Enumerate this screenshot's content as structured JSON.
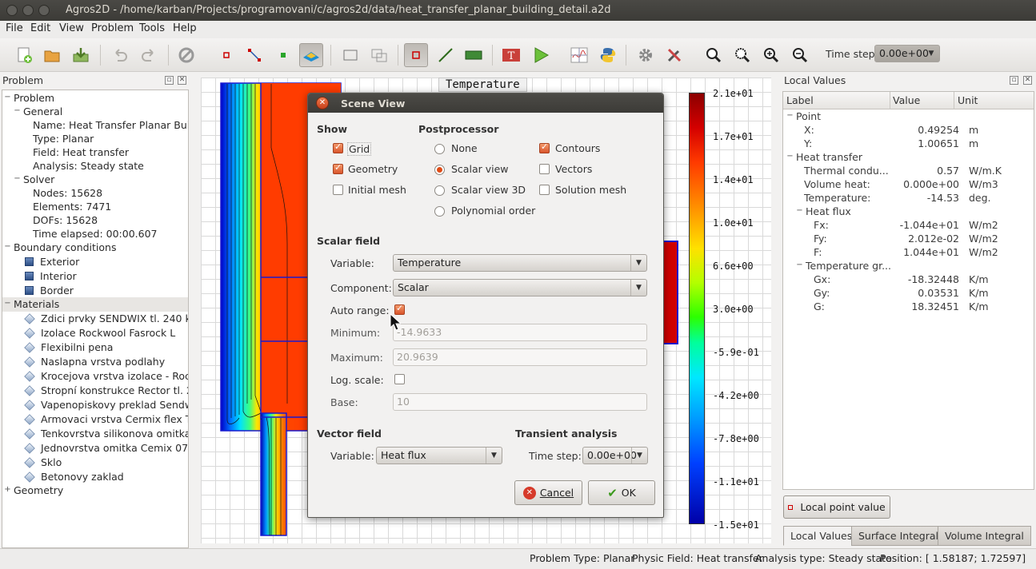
{
  "window": {
    "title": "Agros2D - /home/karban/Projects/programovani/c/agros2d/data/heat_transfer_planar_building_detail.a2d"
  },
  "menu": [
    "File",
    "Edit",
    "View",
    "Problem",
    "Tools",
    "Help"
  ],
  "toolbar": {
    "time_step_label": "Time step:",
    "time_step_value": "0.00e+00"
  },
  "problem_panel": {
    "title": "Problem",
    "tree": {
      "problem": "Problem",
      "general": "General",
      "name": "Name: Heat Transfer Planar Bui...",
      "type": "Type: Planar",
      "field": "Field: Heat transfer",
      "analysis": "Analysis: Steady state",
      "solver": "Solver",
      "nodes": "Nodes: 15628",
      "elements": "Elements: 7471",
      "dofs": "DOFs: 15628",
      "time_elapsed": "Time elapsed: 00:00.607",
      "boundary_conditions": "Boundary conditions",
      "bcs": [
        "Exterior",
        "Interior",
        "Border"
      ],
      "materials_label": "Materials",
      "materials": [
        "Zdici prvky SENDWIX tl. 240 ko...",
        "Izolace Rockwool Fasrock L",
        "Flexibilni pena",
        "Naslapna vrstva podlahy",
        "Krocejova vrstva izolace - Rock...",
        "Stropní konstrukce Rector tl. 2...",
        "Vapenopiskovy preklad Sendw...",
        "Armovaci vrstva Cermix flex T ...",
        "Tenkovrstva silikonova omitka ...",
        "Jednovrstva omitka Cemix 073...",
        "Sklo",
        "Betonovy zaklad"
      ],
      "geometry": "Geometry"
    }
  },
  "scene": {
    "title": "Temperature",
    "colorbar_labels": [
      "2.1e+01",
      "1.7e+01",
      "1.4e+01",
      "1.0e+01",
      "6.6e+00",
      "3.0e+00",
      "-5.9e-01",
      "-4.2e+00",
      "-7.8e+00",
      "-1.1e+01",
      "-1.5e+01"
    ]
  },
  "dialog": {
    "title": "Scene View",
    "show_header": "Show",
    "grid": "Grid",
    "geometry": "Geometry",
    "initial_mesh": "Initial mesh",
    "post_header": "Postprocessor",
    "none": "None",
    "scalar_view": "Scalar view",
    "scalar_view_3d": "Scalar view 3D",
    "polynomial_order": "Polynomial order",
    "contours": "Contours",
    "vectors": "Vectors",
    "solution_mesh": "Solution mesh",
    "scalar_field_header": "Scalar field",
    "variable_label": "Variable:",
    "variable_value": "Temperature",
    "component_label": "Component:",
    "component_value": "Scalar",
    "auto_range_label": "Auto range:",
    "minimum_label": "Minimum:",
    "minimum_value": "-14.9633",
    "maximum_label": "Maximum:",
    "maximum_value": "20.9639",
    "log_scale_label": "Log. scale:",
    "base_label": "Base:",
    "base_value": "10",
    "vector_field_header": "Vector field",
    "vector_variable_label": "Variable:",
    "vector_variable_value": "Heat flux",
    "transient_header": "Transient analysis",
    "time_step_label": "Time step:",
    "time_step_value": "0.00e+00",
    "cancel": "Cancel",
    "ok": "OK"
  },
  "local_values": {
    "title": "Local Values",
    "headers": [
      "Label",
      "Value",
      "Unit"
    ],
    "point": "Point",
    "x": {
      "label": "X:",
      "value": "0.49254",
      "unit": "m"
    },
    "y": {
      "label": "Y:",
      "value": "1.00651",
      "unit": "m"
    },
    "heat_transfer": "Heat transfer",
    "thermal": {
      "label": "Thermal condu...",
      "value": "0.57",
      "unit": "W/m.K"
    },
    "volume_heat": {
      "label": "Volume heat:",
      "value": "0.000e+00",
      "unit": "W/m3"
    },
    "temperature": {
      "label": "Temperature:",
      "value": "-14.53",
      "unit": "deg."
    },
    "heat_flux": "Heat flux",
    "fx": {
      "label": "Fx:",
      "value": "-1.044e+01",
      "unit": "W/m2"
    },
    "fy": {
      "label": "Fy:",
      "value": "2.012e-02",
      "unit": "W/m2"
    },
    "f": {
      "label": "F:",
      "value": "1.044e+01",
      "unit": "W/m2"
    },
    "temp_gradient": "Temperature gr...",
    "gx": {
      "label": "Gx:",
      "value": "-18.32448",
      "unit": "K/m"
    },
    "gy": {
      "label": "Gy:",
      "value": "0.03531",
      "unit": "K/m"
    },
    "g": {
      "label": "G:",
      "value": "18.32451",
      "unit": "K/m"
    },
    "local_point_button": "Local point value"
  },
  "tabs": [
    "Local Values",
    "Surface Integral",
    "Volume Integral"
  ],
  "status": {
    "problem_type": "Problem Type: Planar",
    "physic_field": "Physic Field: Heat transfer",
    "analysis_type": "Analysis type: Steady state",
    "position": "Position: [ 1.58187;  1.72597]"
  },
  "colors": {
    "accent": "#df4b16",
    "titlebar": "#3c3b37"
  }
}
